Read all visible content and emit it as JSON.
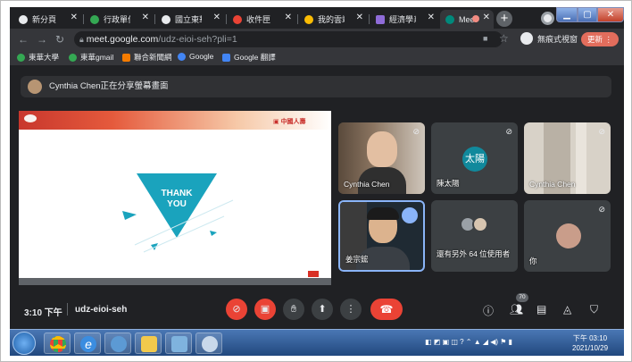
{
  "browser": {
    "tabs": [
      {
        "title": "新分頁",
        "color": "#e8eaed"
      },
      {
        "title": "行政單位",
        "color": "#34a853"
      },
      {
        "title": "國立東華大",
        "color": "#e8eaed"
      },
      {
        "title": "收件匣 (8)",
        "color": "#ea4335"
      },
      {
        "title": "我的雲端硬",
        "color": "#fbbc04"
      },
      {
        "title": "經濟學系",
        "color": "#8f6cd8"
      },
      {
        "title": "Meet",
        "color": "#00897b"
      }
    ],
    "url_host": "meet.google.com",
    "url_path": "/udz-eioi-seh?pli=1",
    "incognito_label": "無痕式視窗",
    "update_label": "更新",
    "bookmarks": [
      {
        "label": "東華大學",
        "color": "#34a853"
      },
      {
        "label": "東華gmail",
        "color": "#34a853"
      },
      {
        "label": "聯合新聞網",
        "color": "#f57c00"
      },
      {
        "label": "Google",
        "color": "#4285f4"
      },
      {
        "label": "Google 翻譯",
        "color": "#4285f4"
      }
    ]
  },
  "meet": {
    "share_banner": "Cynthia Chen正在分享螢幕畫面",
    "slide": {
      "logo_text": "中國人壽",
      "thank": "THANK",
      "you": "YOU"
    },
    "participants": [
      {
        "name": "Cynthia Chen",
        "avatar": ""
      },
      {
        "name": "陳太陽",
        "avatar": "太陽"
      },
      {
        "name": "Cynthia Chen",
        "avatar": ""
      },
      {
        "name": "姜宗鋐",
        "avatar": ""
      },
      {
        "name": "還有另外 64 位使用者",
        "avatar": ""
      },
      {
        "name": "你",
        "avatar": ""
      }
    ],
    "time": "3:10 下午",
    "meeting_code": "udz-eioi-seh",
    "participant_count": "70"
  },
  "taskbar": {
    "clock_time": "下午 03:10",
    "clock_date": "2021/10/29"
  }
}
